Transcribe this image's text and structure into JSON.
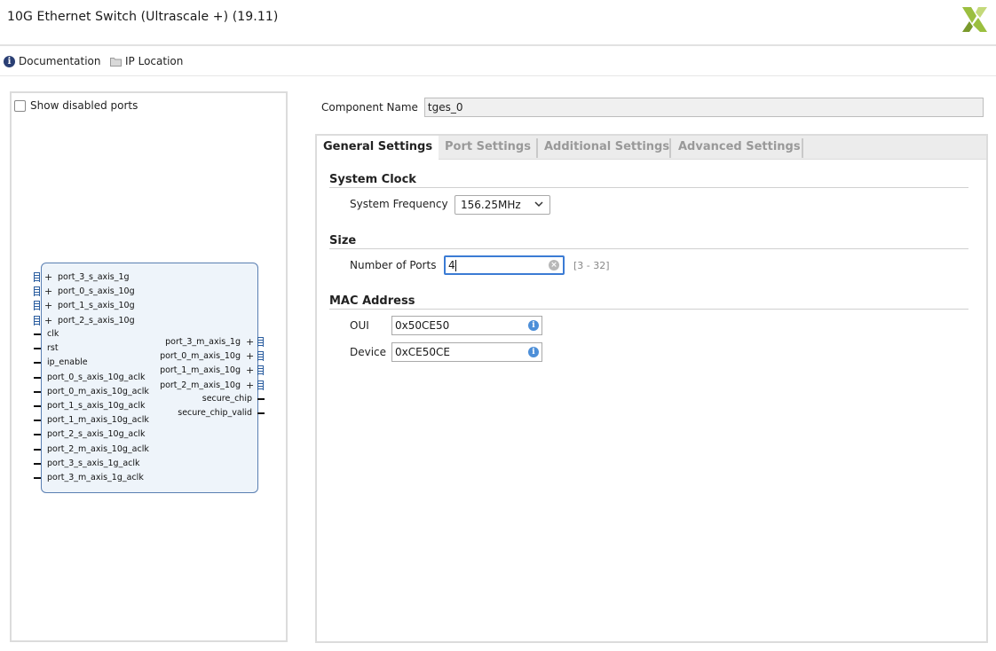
{
  "window": {
    "title": "10G Ethernet Switch (Ultrascale +) (19.11)"
  },
  "toolbar": {
    "documentation": "Documentation",
    "ip_location": "IP Location"
  },
  "left": {
    "show_disabled_ports": "Show disabled ports",
    "block": {
      "left_bus_ports": [
        "port_3_s_axis_1g",
        "port_0_s_axis_10g",
        "port_1_s_axis_10g",
        "port_2_s_axis_10g"
      ],
      "left_ports": [
        "clk",
        "rst",
        "ip_enable",
        "port_0_s_axis_10g_aclk",
        "port_0_m_axis_10g_aclk",
        "port_1_s_axis_10g_aclk",
        "port_1_m_axis_10g_aclk",
        "port_2_s_axis_10g_aclk",
        "port_2_m_axis_10g_aclk",
        "port_3_s_axis_1g_aclk",
        "port_3_m_axis_1g_aclk"
      ],
      "right_bus_ports": [
        "port_3_m_axis_1g",
        "port_0_m_axis_10g",
        "port_1_m_axis_10g",
        "port_2_m_axis_10g"
      ],
      "right_ports": [
        "secure_chip",
        "secure_chip_valid"
      ]
    }
  },
  "component": {
    "label": "Component Name",
    "value": "tges_0"
  },
  "tabs": [
    "General Settings",
    "Port Settings",
    "Additional Settings",
    "Advanced Settings"
  ],
  "general": {
    "system_clock": {
      "title": "System Clock",
      "freq_label": "System Frequency",
      "freq_value": "156.25MHz"
    },
    "size": {
      "title": "Size",
      "ports_label": "Number of Ports",
      "ports_value": "4",
      "range": "[3 - 32]"
    },
    "mac": {
      "title": "MAC Address",
      "oui_label": "OUI",
      "oui_value": "0x50CE50",
      "device_label": "Device",
      "device_value": "0xCE50CE"
    }
  },
  "colors": {
    "logo": "#8fb33a",
    "accent": "#3b7bd4",
    "block_fill": "#eef4fa"
  }
}
